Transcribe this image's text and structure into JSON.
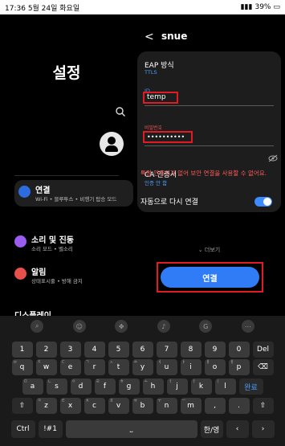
{
  "status": {
    "time": "17:36",
    "date": "5월 24일 화요일",
    "battery": "39%"
  },
  "settings": {
    "title": "설정",
    "items": [
      {
        "title": "연결",
        "subtitle": "Wi-Fi • 블루투스 • 비행기 탑승 모드",
        "color": "#2d6cdf"
      },
      {
        "title": "소리 및 진동",
        "subtitle": "소리 모드 • 벨소리",
        "color": "#9b5cf0"
      },
      {
        "title": "알림",
        "subtitle": "상태표시줄 • 방해 금지",
        "color": "#e8504c"
      },
      {
        "title": "디스플레이",
        "subtitle": ""
      }
    ]
  },
  "network": {
    "back": "<",
    "name": "snue",
    "eap_label": "EAP 방식",
    "eap_value": "TTLS",
    "id_label": "ID",
    "id_value": "temp",
    "pw_label": "비밀번호",
    "pw_value": "••••••••••",
    "ca_label": "CA 인증서",
    "ca_value": "인증 안 함",
    "warning": "특정 인증서가 없어 보안 연결을 사용할 수 없어요.",
    "reconnect_label": "자동으로 다시 연결",
    "more": "더보기",
    "connect": "연결"
  },
  "keyboard": {
    "numbers": [
      "1",
      "2",
      "3",
      "4",
      "5",
      "6",
      "7",
      "8",
      "9",
      "0"
    ],
    "row1": [
      "q",
      "w",
      "e",
      "r",
      "t",
      "y",
      "u",
      "i",
      "o",
      "p"
    ],
    "row1_sub": [
      "ㅂ",
      "ㅈ",
      "ㄷ",
      "ㄱ",
      "ㅅ",
      "ㅛ",
      "ㅕ",
      "ㅑ",
      "ㅐ",
      "ㅔ"
    ],
    "row2": [
      "a",
      "s",
      "d",
      "f",
      "g",
      "h",
      "j",
      "k",
      "l"
    ],
    "row2_sub": [
      "ㅁ",
      "ㄴ",
      "ㅇ",
      "ㄹ",
      "ㅎ",
      "ㅗ",
      "ㅓ",
      "ㅏ",
      "ㅣ"
    ],
    "row3": [
      "z",
      "x",
      "c",
      "v",
      "b",
      "n",
      "m",
      ",",
      "."
    ],
    "row3_sub": [
      "ㅋ",
      "ㅌ",
      "ㅊ",
      "ㅍ",
      "ㅠ",
      "ㅜ",
      "ㅡ",
      "",
      ""
    ],
    "del": "Del",
    "done": "완료",
    "ctrl": "Ctrl",
    "symbols": "!#1",
    "lang": "한/영"
  }
}
